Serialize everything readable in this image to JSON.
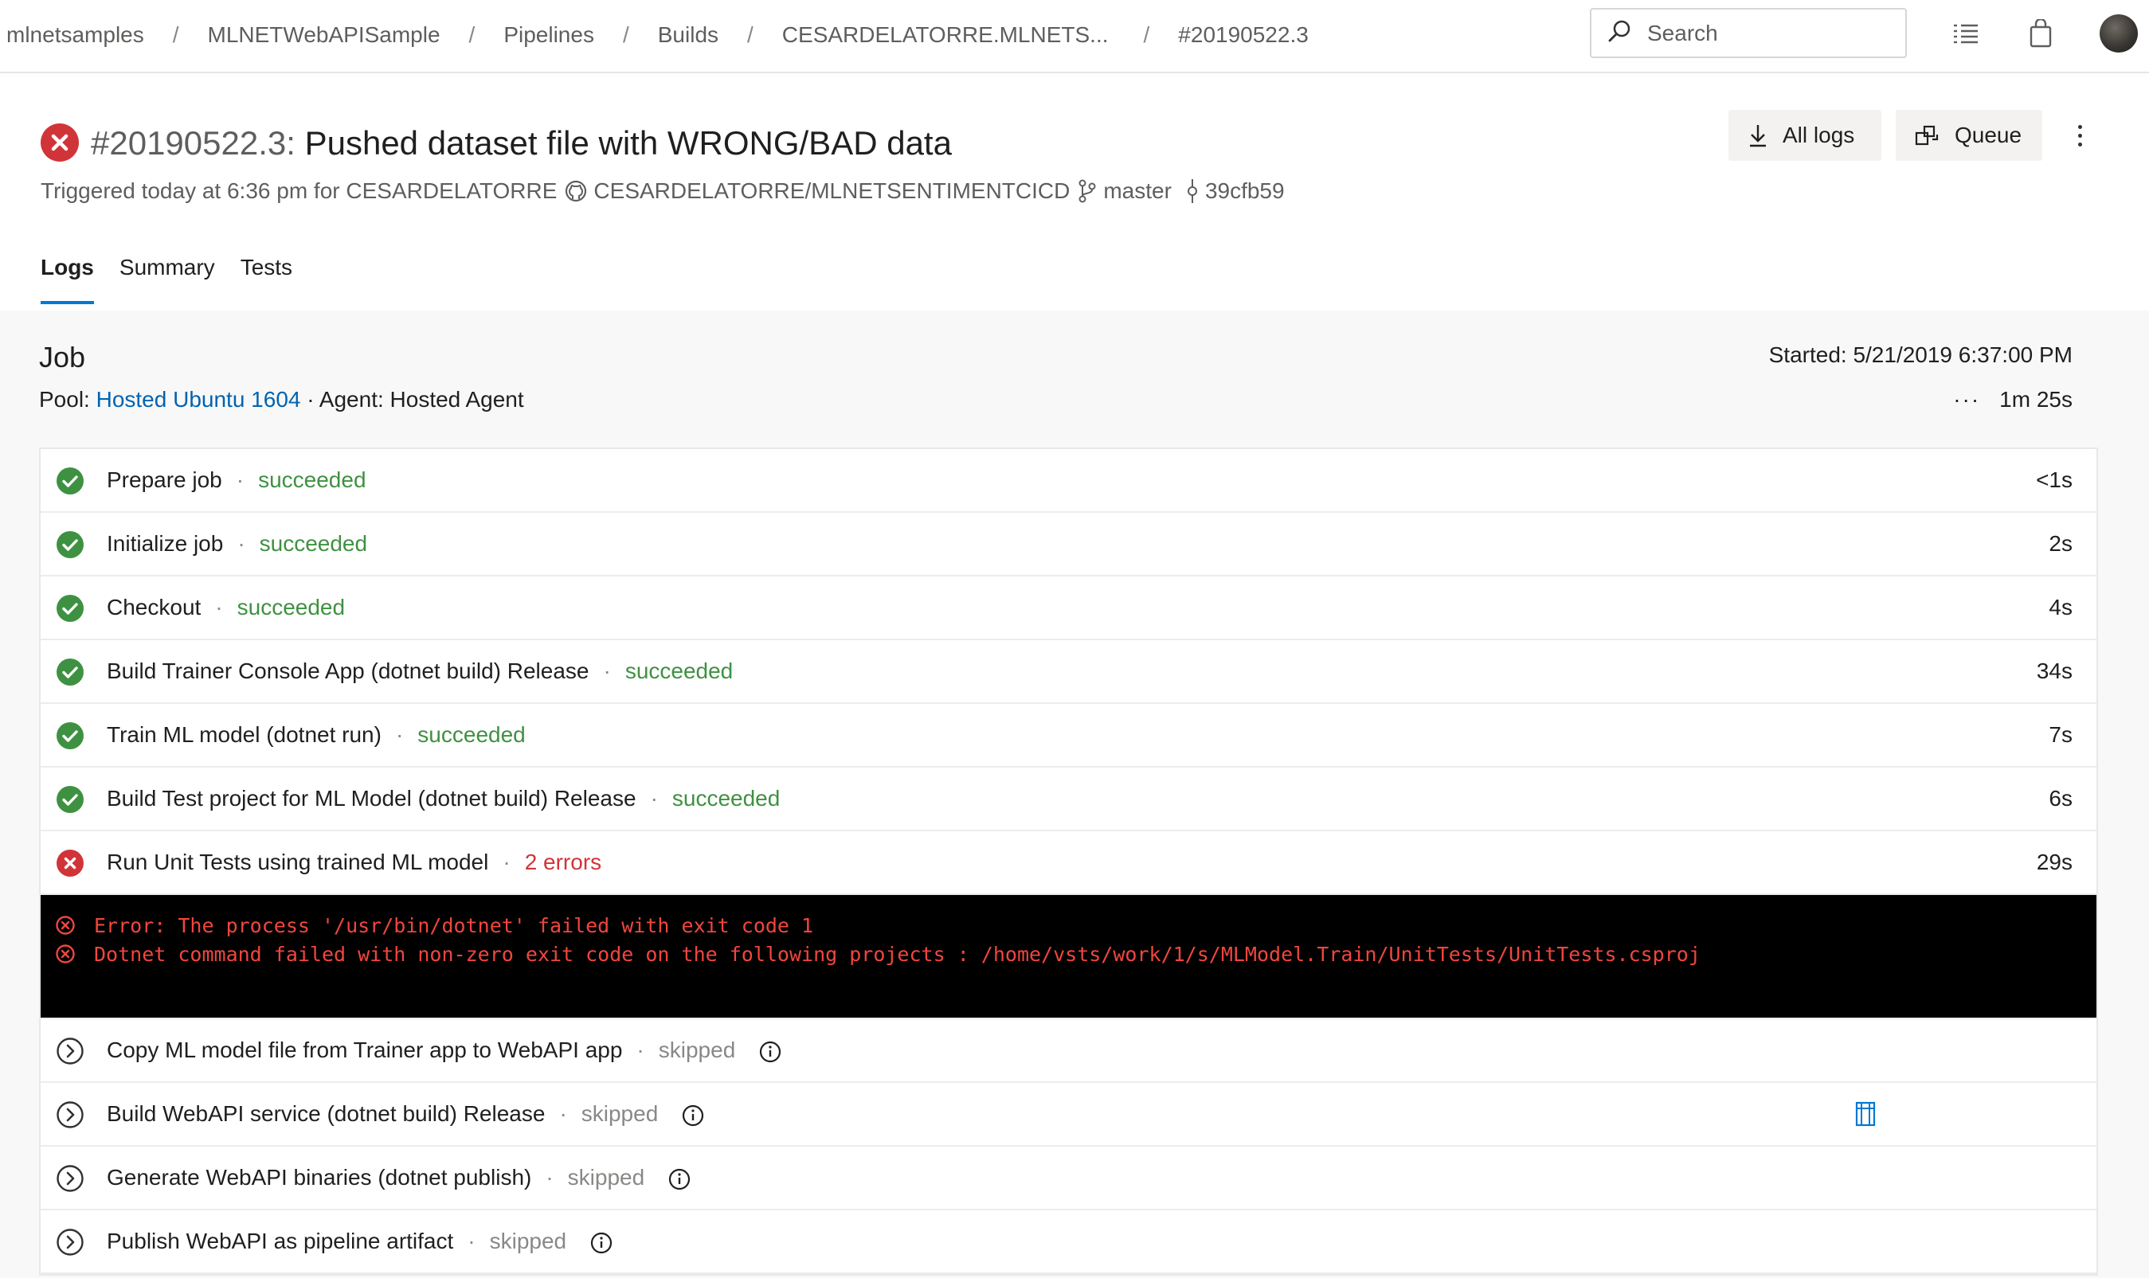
{
  "breadcrumb": {
    "items": [
      "mlnetsamples",
      "MLNETWebAPISample",
      "Pipelines",
      "Builds",
      "CESARDELATORRE.MLNETS...",
      "#20190522.3"
    ],
    "separator": "/"
  },
  "search": {
    "placeholder": "Search"
  },
  "topbar_icons": [
    "list-icon",
    "shopping-bag-icon",
    "avatar"
  ],
  "build": {
    "status": "failed",
    "number": "#20190522.3:",
    "message": "Pushed dataset file with WRONG/BAD data",
    "trigger_text": "Triggered today at 6:36 pm for CESARDELATORRE",
    "repo": "CESARDELATORRE/MLNETSENTIMENTCICD",
    "branch": "master",
    "commit": "39cfb59"
  },
  "actions": {
    "all_logs": "All logs",
    "queue": "Queue"
  },
  "tabs": [
    "Logs",
    "Summary",
    "Tests"
  ],
  "active_tab": "Logs",
  "job": {
    "title": "Job",
    "started": "Started: 5/21/2019 6:37:00 PM",
    "pool_label": "Pool:",
    "pool_name": "Hosted Ubuntu 1604",
    "agent": "· Agent: Hosted Agent",
    "more": "···",
    "duration": "1m 25s"
  },
  "steps": [
    {
      "name": "Prepare job",
      "sep": "·",
      "status": "succeeded",
      "duration": "<1s",
      "kind": "ok"
    },
    {
      "name": "Initialize job",
      "sep": "·",
      "status": "succeeded",
      "duration": "2s",
      "kind": "ok"
    },
    {
      "name": "Checkout",
      "sep": "·",
      "status": "succeeded",
      "duration": "4s",
      "kind": "ok"
    },
    {
      "name": "Build Trainer Console App (dotnet build) Release",
      "sep": "·",
      "status": "succeeded",
      "duration": "34s",
      "kind": "ok"
    },
    {
      "name": "Train ML model (dotnet run)",
      "sep": "·",
      "status": "succeeded",
      "duration": "7s",
      "kind": "ok"
    },
    {
      "name": "Build Test project for ML Model (dotnet build) Release",
      "sep": "·",
      "status": "succeeded",
      "duration": "6s",
      "kind": "ok"
    },
    {
      "name": "Run Unit Tests using trained ML model",
      "sep": "·",
      "status": "2 errors",
      "duration": "29s",
      "kind": "err"
    }
  ],
  "console_errors": [
    "Error: The process '/usr/bin/dotnet' failed with exit code 1",
    "Dotnet command failed with non-zero exit code on the following projects : /home/vsts/work/1/s/MLModel.Train/UnitTests/UnitTests.csproj"
  ],
  "skipped_steps": [
    {
      "name": "Copy ML model file from Trainer app to WebAPI app",
      "sep": "·",
      "status": "skipped"
    },
    {
      "name": "Build WebAPI service (dotnet build) Release",
      "sep": "·",
      "status": "skipped"
    },
    {
      "name": "Generate WebAPI binaries (dotnet publish)",
      "sep": "·",
      "status": "skipped"
    },
    {
      "name": "Publish WebAPI as pipeline artifact",
      "sep": "·",
      "status": "skipped"
    }
  ],
  "colors": {
    "success": "#3f9142",
    "error": "#d13438",
    "link": "#0063b1",
    "accent": "#0078d4",
    "console_bg": "#000000",
    "console_text": "#f0463e"
  }
}
